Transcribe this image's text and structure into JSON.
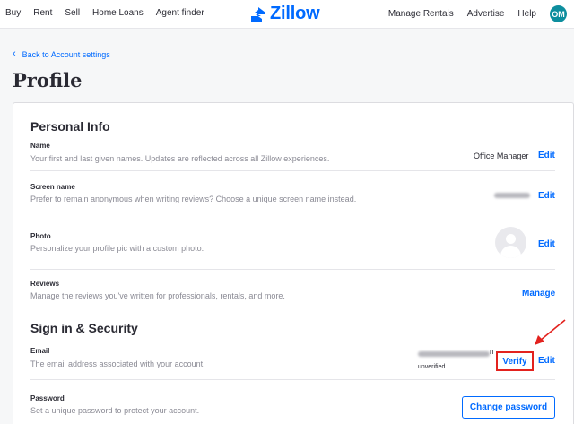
{
  "nav": {
    "left": [
      "Buy",
      "Rent",
      "Sell",
      "Home Loans",
      "Agent finder"
    ],
    "right": [
      "Manage Rentals",
      "Advertise",
      "Help"
    ],
    "logo_text": "Zillow",
    "user_initials": "OM"
  },
  "back_link": "Back to Account settings",
  "page_title": "Profile",
  "personal_info": {
    "title": "Personal Info",
    "name": {
      "label": "Name",
      "desc": "Your first and last given names. Updates are reflected across all Zillow experiences.",
      "value": "Office Manager",
      "action": "Edit"
    },
    "screen_name": {
      "label": "Screen name",
      "desc": "Prefer to remain anonymous when writing reviews? Choose a unique screen name instead.",
      "action": "Edit"
    },
    "photo": {
      "label": "Photo",
      "desc": "Personalize your profile pic with a custom photo.",
      "action": "Edit"
    },
    "reviews": {
      "label": "Reviews",
      "desc": "Manage the reviews you've written for professionals, rentals, and more.",
      "action": "Manage"
    }
  },
  "security": {
    "title": "Sign in & Security",
    "email": {
      "label": "Email",
      "desc": "The email address associated with your account.",
      "status": "unverified",
      "value_suffix": "n",
      "verify": "Verify",
      "action": "Edit"
    },
    "password": {
      "label": "Password",
      "desc": "Set a unique password to protect your account.",
      "action": "Change password"
    }
  },
  "colors": {
    "brand": "#006aff",
    "highlight": "#e3221e",
    "avatar": "#0d8e9e"
  }
}
